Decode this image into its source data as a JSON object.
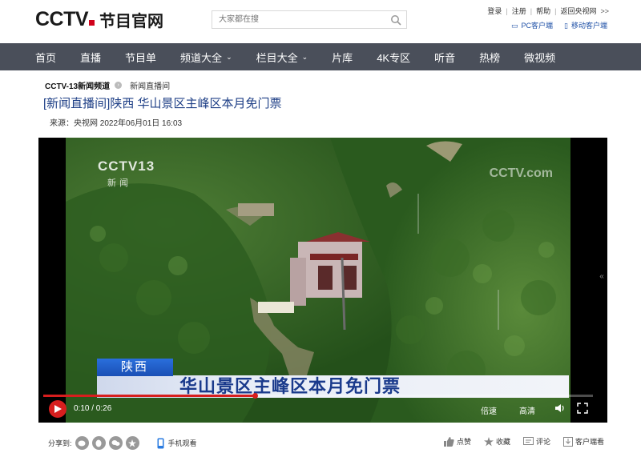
{
  "header": {
    "logo_text": "CCTV",
    "logo_sub": "节目官网",
    "search_placeholder": "大家都在搜",
    "links": [
      "登录",
      "注册",
      "帮助",
      "返回央视网"
    ],
    "client_links": [
      "PC客户端",
      "移动客户端"
    ]
  },
  "nav": {
    "items": [
      "首页",
      "直播",
      "节目单",
      "频道大全",
      "栏目大全",
      "片库",
      "4K专区",
      "听音",
      "热榜",
      "微视频"
    ]
  },
  "breadcrumb": {
    "channel": "CCTV-13新闻频道",
    "section": "新闻直播间"
  },
  "article": {
    "title": "[新闻直播间]陕西 华山景区主峰区本月免门票",
    "meta": "来源：央视网  2022年06月01日 16:03"
  },
  "player": {
    "watermark_logo": "CCTV13",
    "watermark_sub": "新闻",
    "watermark_right": "CCTV.com",
    "caption_tag": "陕西",
    "caption_text": "华山景区主峰区本月免门票",
    "time": "0:10 / 0:26",
    "progress": 0.385,
    "speed_label": "倍速",
    "quality_label": "高清",
    "side_arrow": "«"
  },
  "share": {
    "label": "分享到:",
    "mobile_label": "手机观看"
  },
  "actions": {
    "like": "点赞",
    "collect": "收藏",
    "comment": "评论",
    "client_watch": "客户端看"
  },
  "colors": {
    "nav_bg": "#4a4f5a",
    "title_blue": "#1e3f86",
    "accent_red": "#d71e1e"
  }
}
